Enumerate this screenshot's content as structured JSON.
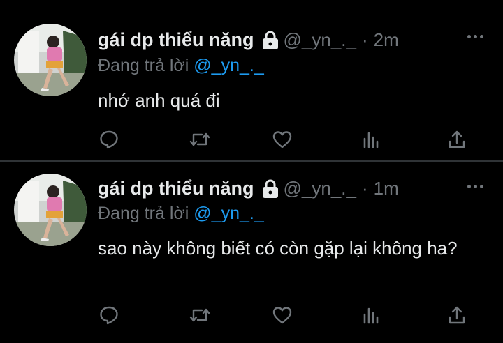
{
  "tweets": [
    {
      "display_name": "gái dp thiểu năng",
      "handle": "@_yn_._",
      "separator": "·",
      "time": "2m",
      "reply_prefix": "Đang trả lời",
      "reply_mention": "@_yn_._",
      "text": "nhớ anh quá đi",
      "avatar": "avatar-photo",
      "protected_icon": "lock-icon"
    },
    {
      "display_name": "gái dp thiểu năng",
      "handle": "@_yn_._",
      "separator": "·",
      "time": "1m",
      "reply_prefix": "Đang trả lời",
      "reply_mention": "@_yn_._",
      "text": "sao này không biết có còn gặp lại không ha?",
      "avatar": "avatar-photo",
      "protected_icon": "lock-icon"
    }
  ],
  "action_icons": [
    "reply-icon",
    "retweet-icon",
    "like-icon",
    "views-icon",
    "share-icon"
  ],
  "colors": {
    "background": "#000000",
    "primary_text": "#e7e9ea",
    "secondary_text": "#71767b",
    "mention": "#1d9bf0",
    "divider": "#2f3336"
  }
}
